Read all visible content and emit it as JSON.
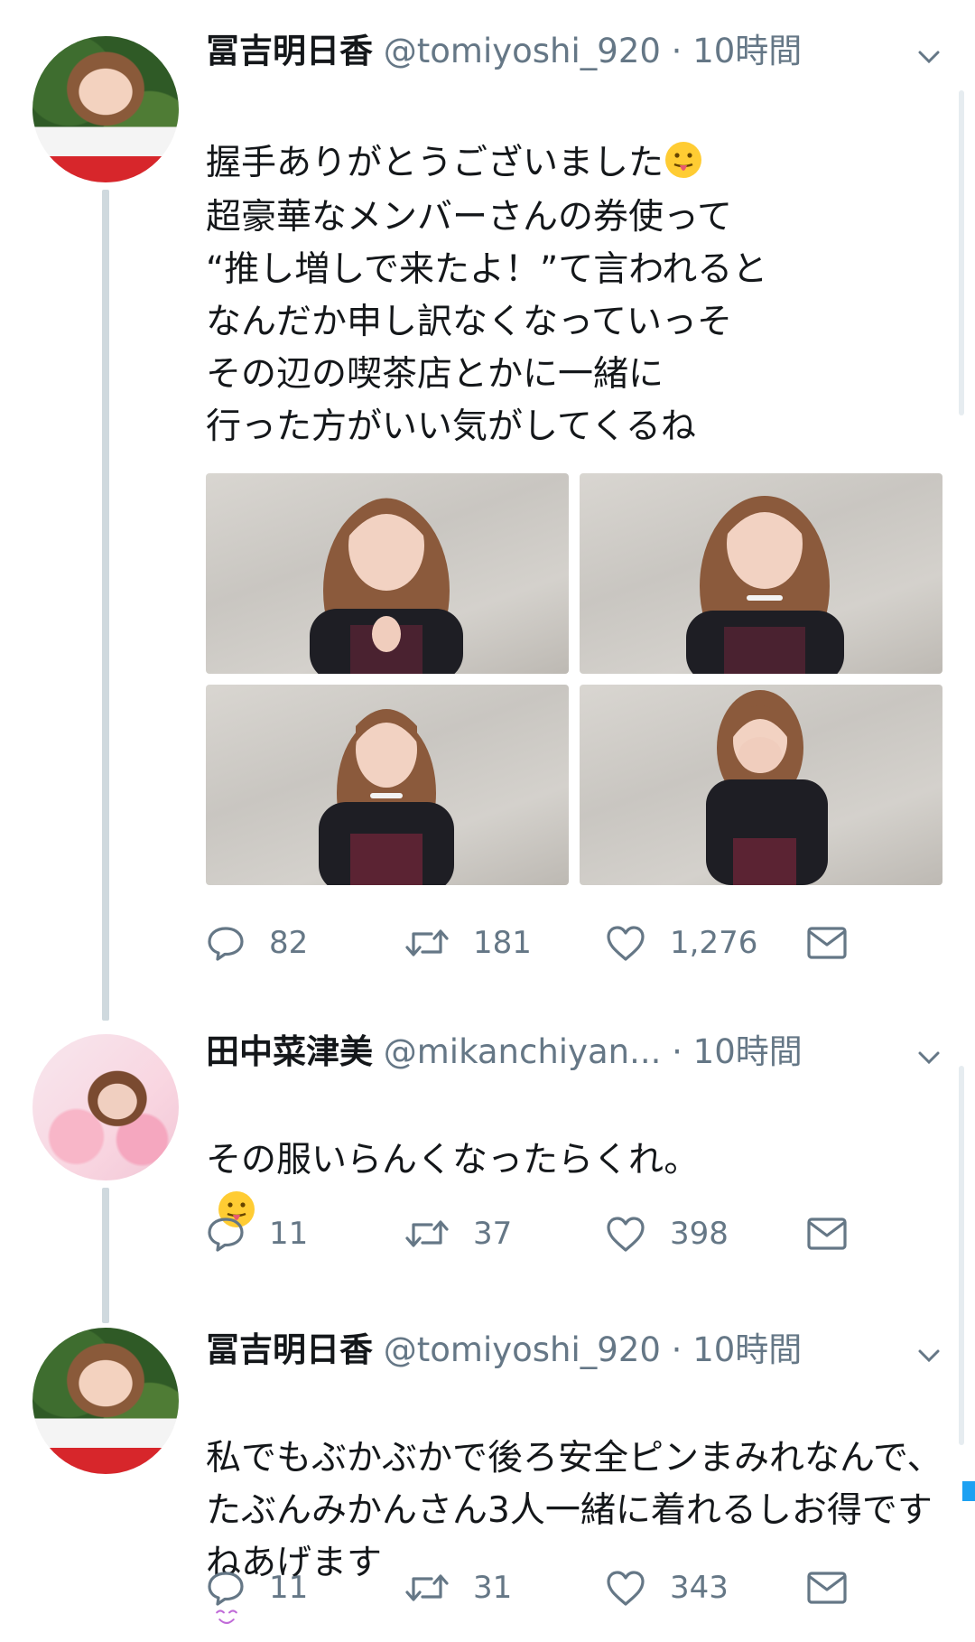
{
  "tweets": [
    {
      "name": "冨吉明日香",
      "handle": "@tomiyoshi_920",
      "time": "· 10時間",
      "text_line1": "握手ありがとうございました",
      "text_rest": "超豪華なメンバーさんの券使って\n“推し増しで来たよ！”て言われると\nなんだか申し訳なくなっていっそ\nその辺の喫茶店とかに一緒に\n行った方がいい気がしてくるね",
      "replies": "82",
      "retweets": "181",
      "likes": "1,276"
    },
    {
      "name": "田中菜津美",
      "handle": "@mikanchiyan...",
      "time": "· 10時間",
      "text": "その服いらんくなったらくれ。",
      "replies": "11",
      "retweets": "37",
      "likes": "398"
    },
    {
      "name": "冨吉明日香",
      "handle": "@tomiyoshi_920",
      "time": "· 10時間",
      "text": "私でもぶかぶかで後ろ安全ピンまみれなんで、たぶんみかんさん3人一緒に着れるしお得ですねあげます",
      "replies": "11",
      "retweets": "31",
      "likes": "343"
    }
  ],
  "colors": {
    "text": "#14171a",
    "secondary": "#657786",
    "thread_line": "#cfd9de",
    "accent": "#1da1f2"
  },
  "icons": [
    "reply-icon",
    "retweet-icon",
    "like-icon",
    "share-mail-icon",
    "chevron-down-icon",
    "tongue-emoji-icon",
    "smile-emoji-icon"
  ]
}
